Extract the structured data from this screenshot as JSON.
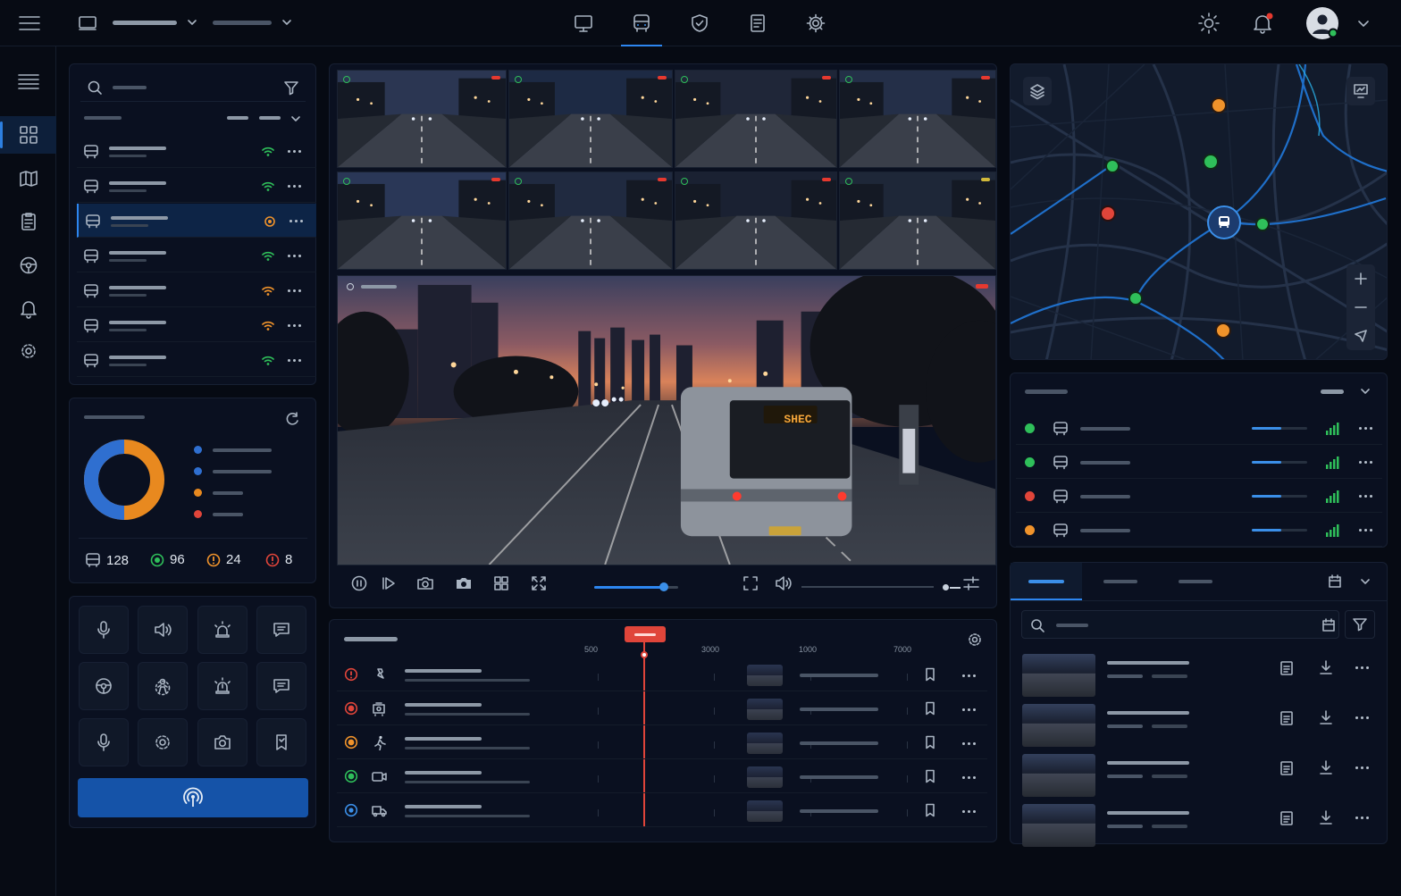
{
  "fleet_summary": {
    "total": "128",
    "online": "96",
    "warnings": "24",
    "alerts": "8"
  },
  "timeline": {
    "ticks": [
      "500",
      "3000",
      "1000",
      "7000"
    ]
  },
  "video": {
    "bus_sign": "SHEC"
  },
  "vehicles": [
    {
      "signal": "green"
    },
    {
      "signal": "green"
    },
    {
      "signal": "orange"
    },
    {
      "signal": "green"
    },
    {
      "signal": "orange"
    },
    {
      "signal": "orange"
    },
    {
      "signal": "green"
    }
  ],
  "status_rows": [
    {
      "status_color": "#2fbf5a"
    },
    {
      "status_color": "#2fbf5a"
    },
    {
      "status_color": "#e0453a"
    },
    {
      "status_color": "#f0932b"
    }
  ],
  "events": [
    {
      "color": "#e0453a",
      "icon": "alert-circle-icon",
      "type_icon": "emergency-icon"
    },
    {
      "color": "#e0453a",
      "icon": "record-icon",
      "type_icon": "vehicle-camera-icon"
    },
    {
      "color": "#f0932b",
      "icon": "record-icon",
      "type_icon": "pedestrian-icon"
    },
    {
      "color": "#2fbf5a",
      "icon": "record-icon",
      "type_icon": "video-icon"
    },
    {
      "color": "#3b8fe8",
      "icon": "info-circle-icon",
      "type_icon": "truck-icon"
    }
  ],
  "colors": {
    "accent": "#2d86f0",
    "primary_button": "#1553a8",
    "ok": "#2fbf5a",
    "warn": "#f0932b",
    "alert": "#e0453a",
    "donut_blue": "#2f6fd0",
    "donut_orange": "#e8891f"
  },
  "donut": {
    "segments": [
      {
        "color": "#2f6fd0",
        "fraction": 0.5
      },
      {
        "color": "#e8891f",
        "fraction": 0.5
      }
    ]
  }
}
